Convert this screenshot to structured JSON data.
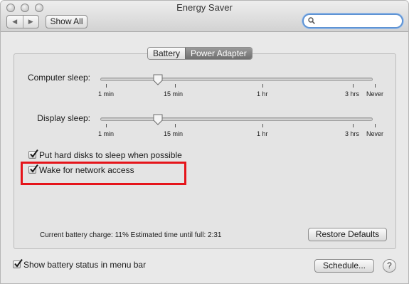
{
  "window": {
    "title": "Energy Saver"
  },
  "toolbar": {
    "back_glyph": "◀",
    "forward_glyph": "▶",
    "show_all_label": "Show All",
    "search": {
      "placeholder": "",
      "value": ""
    }
  },
  "tabs": [
    {
      "label": "Battery",
      "active": false
    },
    {
      "label": "Power Adapter",
      "active": true
    }
  ],
  "sliders": [
    {
      "label": "Computer sleep:",
      "ticks": [
        "1 min",
        "15 min",
        "1 hr",
        "3 hrs",
        "Never"
      ],
      "value": "15 min"
    },
    {
      "label": "Display sleep:",
      "ticks": [
        "1 min",
        "15 min",
        "1 hr",
        "3 hrs",
        "Never"
      ],
      "value": "15 min"
    }
  ],
  "options": [
    {
      "label": "Put hard disks to sleep when possible",
      "checked": true
    },
    {
      "label": "Wake for network access",
      "checked": true
    }
  ],
  "status": {
    "text": "Current battery charge: 11%  Estimated time until full: 2:31"
  },
  "buttons": {
    "restore_defaults": "Restore Defaults",
    "schedule": "Schedule...",
    "help": "?"
  },
  "footer": {
    "show_battery_label": "Show battery status in menu bar",
    "show_battery_checked": true
  },
  "colors": {
    "highlight": "#e5141a",
    "search_focus": "#5f93d3",
    "active_tab": "#7a7a7a"
  }
}
